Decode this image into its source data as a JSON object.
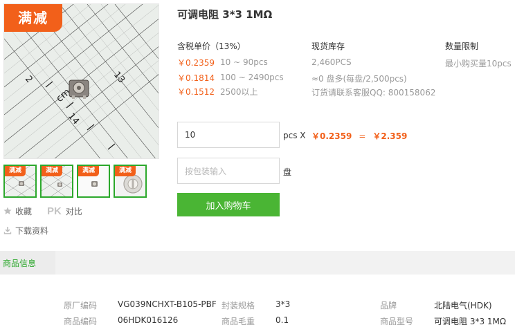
{
  "product": {
    "title": "可调电阻 3*3 1MΩ",
    "promo_tag": "满减"
  },
  "thumbnails": [
    {
      "tag": "满减",
      "active": true
    },
    {
      "tag": "满减",
      "active": true
    },
    {
      "tag": "满减",
      "active": true
    },
    {
      "tag": "满减",
      "active": true
    }
  ],
  "actions": {
    "collect": "收藏",
    "pk": "PK",
    "compare": "对比",
    "download": "下载资料"
  },
  "pricing": {
    "header": "含税单价（13%）",
    "tiers": [
      {
        "price": "￥0.2359",
        "qty": "10 ~ 90pcs"
      },
      {
        "price": "￥0.1814",
        "qty": "100 ~ 2490pcs"
      },
      {
        "price": "￥0.1512",
        "qty": "2500以上"
      }
    ]
  },
  "stock": {
    "header": "现货库存",
    "lines": [
      "2,460PCS",
      "≈0 盘多(每盘/2,500pcs)",
      "订货请联系客服QQ: 800158062"
    ]
  },
  "limit": {
    "header": "数量限制",
    "text": "最小购买量10pcs"
  },
  "order": {
    "qty_value": "10",
    "qty_unit": "pcs X",
    "unit_price": "￥0.2359",
    "equals": "=",
    "total": "￥2.359",
    "reel_placeholder": "按包装输入",
    "reel_unit": "盘",
    "cart_button": "加入购物车"
  },
  "info_tab": "商品信息",
  "specs": {
    "factory_code_label": "原厂编码",
    "factory_code": "VG039NCHXT-B105-PBF",
    "package_label": "封装规格",
    "package": "3*3",
    "brand_label": "品牌",
    "brand": "北陆电气(HDK)",
    "item_code_label": "商品编码",
    "item_code": "06HDK016126",
    "weight_label": "商品毛重",
    "weight": "0.1",
    "model_label": "商品型号",
    "model": "可调电阻 3*3 1MΩ"
  },
  "colors": {
    "accent_orange": "#f2601a",
    "accent_green": "#4ab534",
    "tab_green": "#2ca82c"
  }
}
